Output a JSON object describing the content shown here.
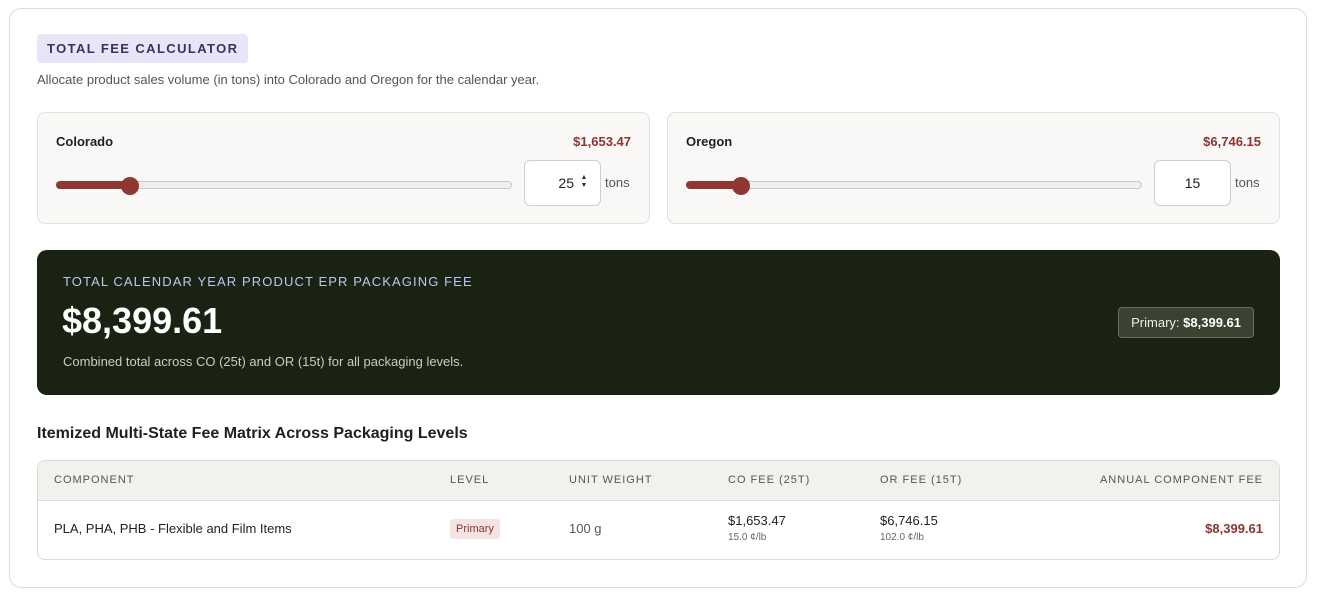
{
  "header": {
    "badge_label": "TOTAL FEE CALCULATOR",
    "subtitle": "Allocate product sales volume (in tons) into Colorado and Oregon for the calendar year."
  },
  "states": [
    {
      "name": "Colorado",
      "fee": "$1,653.47",
      "tons": "25",
      "slider_fraction": 0.16,
      "unit": "tons"
    },
    {
      "name": "Oregon",
      "fee": "$6,746.15",
      "tons": "15",
      "slider_fraction": 0.12,
      "unit": "tons"
    }
  ],
  "total": {
    "label": "TOTAL CALENDAR YEAR PRODUCT EPR PACKAGING FEE",
    "amount": "$8,399.61",
    "caption": "Combined total across CO (25t) and OR (15t) for all packaging levels.",
    "badge_prefix": "Primary:",
    "badge_value": "$8,399.61"
  },
  "matrix": {
    "title": "Itemized Multi-State Fee Matrix Across Packaging Levels",
    "columns": [
      "COMPONENT",
      "LEVEL",
      "UNIT WEIGHT",
      "CO FEE (25T)",
      "OR FEE (15T)",
      "ANNUAL COMPONENT FEE"
    ],
    "rows": [
      {
        "component": "PLA, PHA, PHB - Flexible and Film Items",
        "level": "Primary",
        "unit_weight": "100 g",
        "co_fee": "$1,653.47",
        "co_rate": "15.0 ¢/lb",
        "or_fee": "$6,746.15",
        "or_rate": "102.0 ¢/lb",
        "annual": "$8,399.61"
      }
    ]
  },
  "colors": {
    "accent": "#8f3732",
    "total_bg": "#1a2312",
    "pill_bg": "#e8e5f8"
  }
}
